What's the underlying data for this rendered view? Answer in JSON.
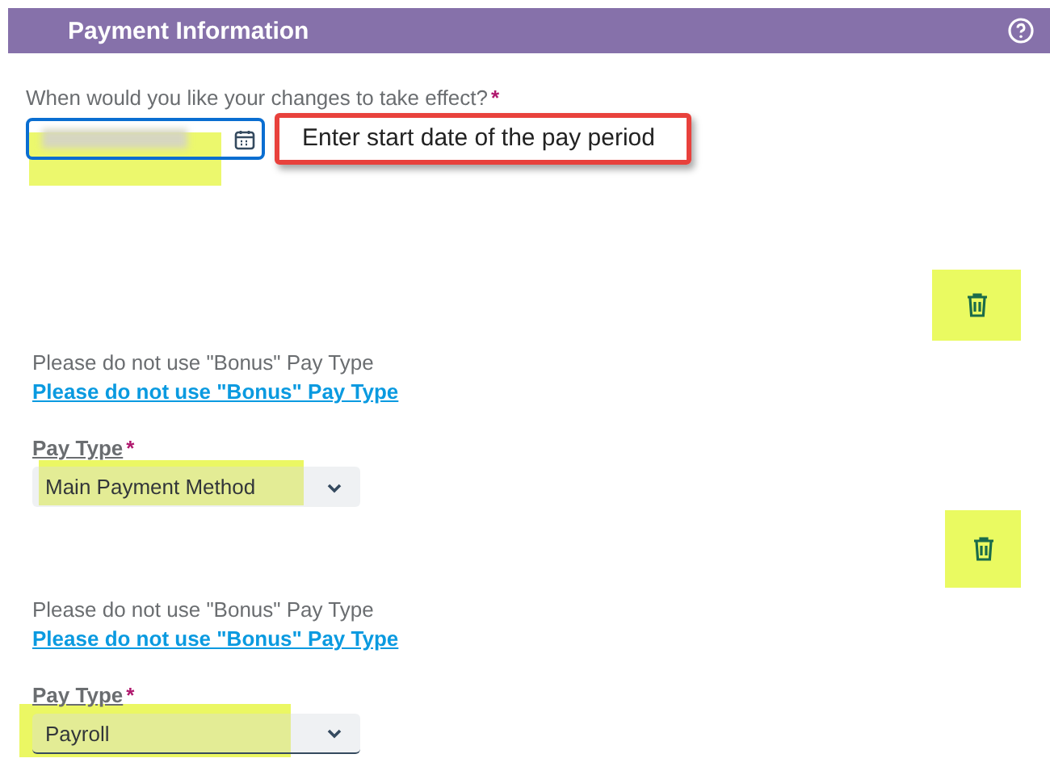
{
  "header": {
    "title": "Payment Information"
  },
  "effective_date": {
    "label": "When would you like your changes to take effect?",
    "required_mark": "*",
    "callout": "Enter start date of the pay period"
  },
  "payments": [
    {
      "note": "Please do not use \"Bonus\" Pay Type",
      "link": "Please do not use \"Bonus\" Pay Type",
      "field_label": "Pay Type",
      "required_mark": "*",
      "value": "Main Payment Method",
      "focused": false
    },
    {
      "note": "Please do not use \"Bonus\" Pay Type",
      "link": "Please do not use \"Bonus\" Pay Type",
      "field_label": "Pay Type",
      "required_mark": "*",
      "value": "Payroll",
      "focused": true
    }
  ]
}
